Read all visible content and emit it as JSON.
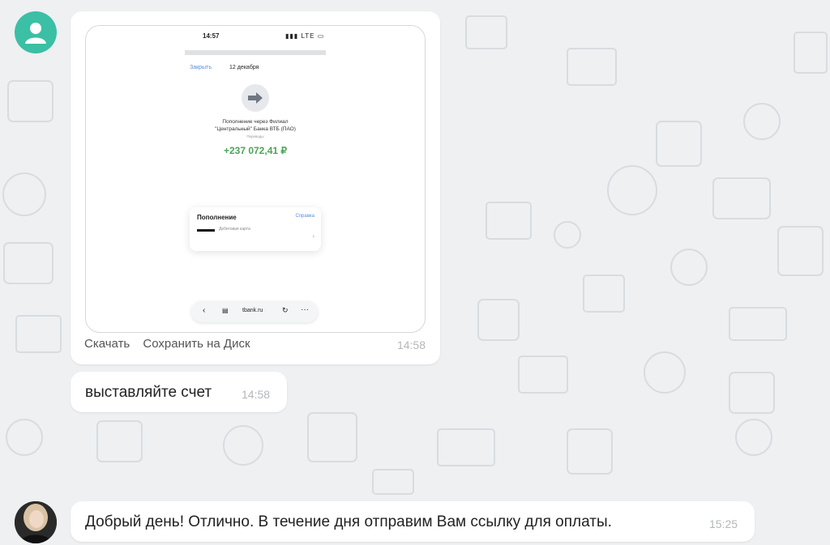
{
  "messages": [
    {
      "type": "image",
      "time": "14:58",
      "actions": [
        "Скачать",
        "Сохранить на Диск"
      ],
      "screenshot": {
        "status_time": "14:57",
        "status_icons": "LTE",
        "close_label": "Закрыть",
        "date": "12 декабря",
        "operation_title_line1": "Пополнение через Филиал",
        "operation_title_line2": "\"Центральный\" Банка ВТБ (ПАО)",
        "operation_subtitle": "Переводы",
        "amount": "+237 072,41 ₽",
        "card_title": "Пополнение",
        "card_help": "Справка",
        "card_account": "Дебетовая карта",
        "browser_url": "tbank.ru"
      }
    },
    {
      "type": "text",
      "text": "выставляйте счет",
      "time": "14:58"
    },
    {
      "type": "text",
      "text": "Добрый день! Отлично. В течение дня отправим Вам ссылку для оплаты.",
      "time": "15:25"
    }
  ],
  "icons": {
    "sender_avatar": "user-silhouette-icon",
    "reply_avatar": "user-photo-avatar",
    "transfer": "arrow-right-icon"
  },
  "colors": {
    "sender_avatar_bg": "#3bbfa5",
    "amount_green": "#4aa558",
    "link_blue": "#5b8fd9"
  }
}
